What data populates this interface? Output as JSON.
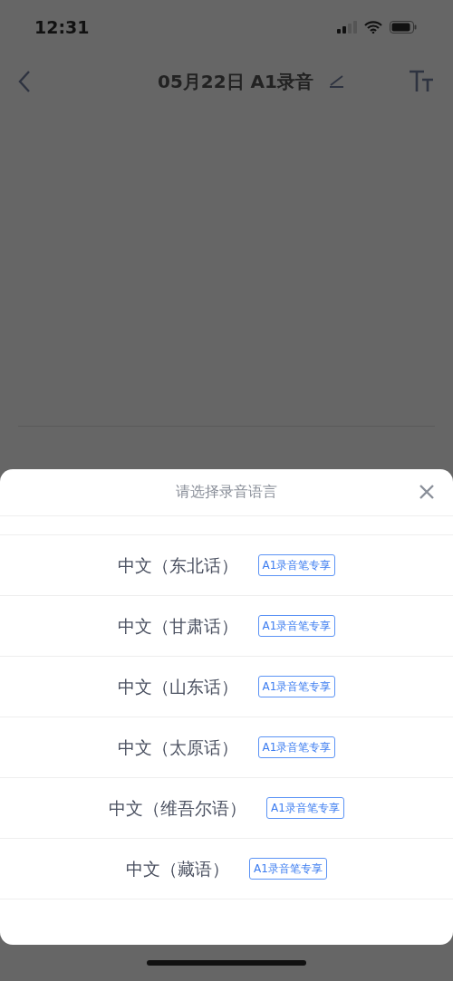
{
  "status_bar": {
    "time": "12:31"
  },
  "header": {
    "title": "05月22日 A1录音"
  },
  "sheet": {
    "title": "请选择录音语言",
    "options": [
      {
        "label": "中文（东北话）",
        "tag": "A1录音笔专享"
      },
      {
        "label": "中文（甘肃话）",
        "tag": "A1录音笔专享"
      },
      {
        "label": "中文（山东话）",
        "tag": "A1录音笔专享"
      },
      {
        "label": "中文（太原话）",
        "tag": "A1录音笔专享"
      },
      {
        "label": "中文（维吾尔语）",
        "tag": "A1录音笔专享"
      },
      {
        "label": "中文（藏语）",
        "tag": "A1录音笔专享"
      }
    ]
  }
}
